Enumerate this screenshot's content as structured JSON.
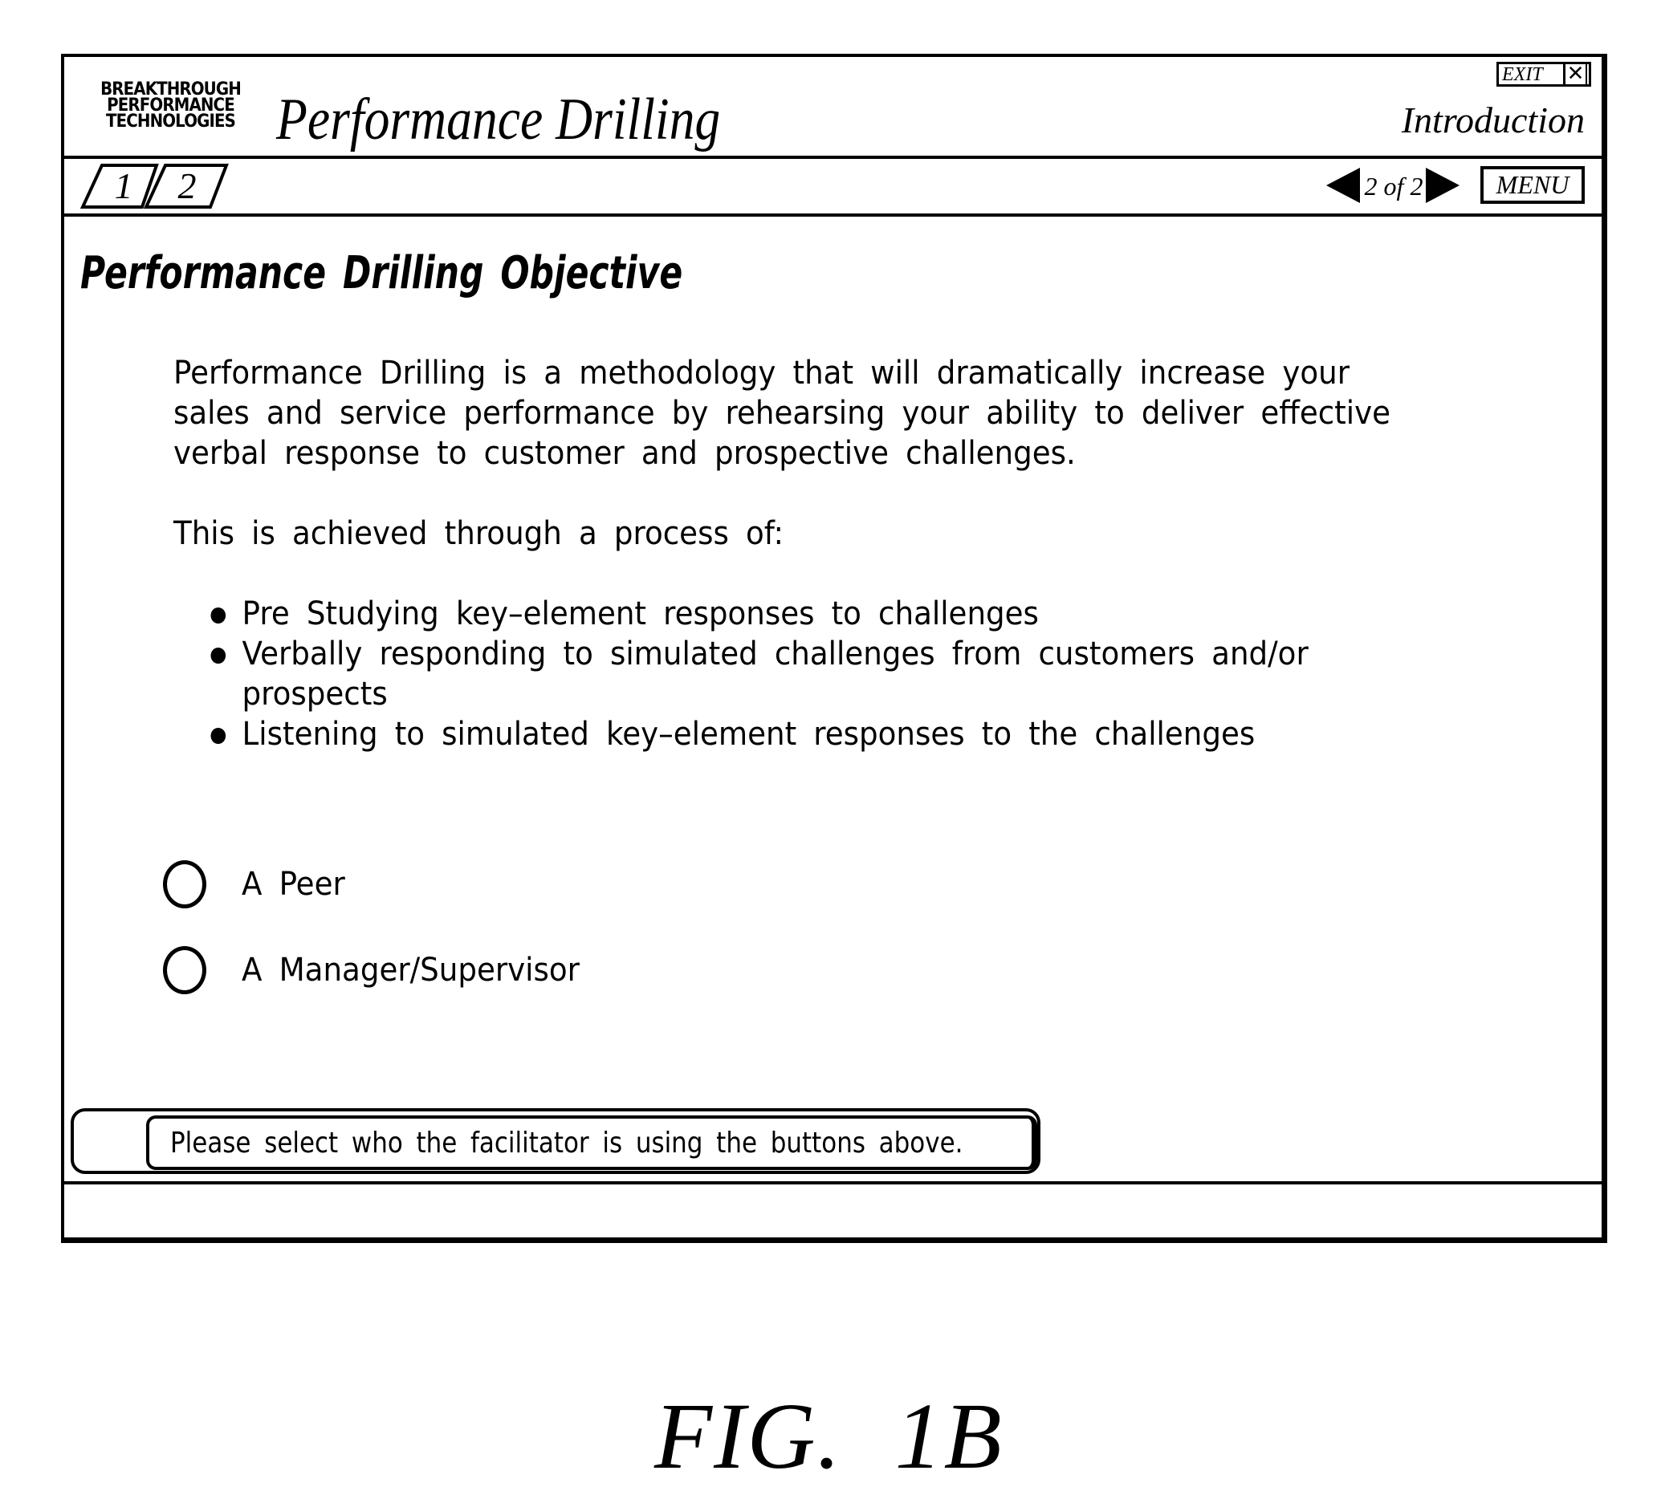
{
  "header": {
    "logo_lines": [
      "BREAKTHROUGH",
      "PERFORMANCE",
      "TECHNOLOGIES"
    ],
    "app_title": "Performance Drilling",
    "exit_label": "EXIT",
    "exit_icon": "close-x-icon",
    "section_title": "Introduction"
  },
  "toolbar": {
    "tabs": [
      {
        "label": "1"
      },
      {
        "label": "2"
      }
    ],
    "prev_icon": "left-triangle-icon",
    "page_indicator": "2 of 2",
    "next_icon": "right-triangle-icon",
    "menu_label": "MENU"
  },
  "content": {
    "heading": "Performance Drilling Objective",
    "intro_lines": [
      "Performance Drilling is a methodology that will dramatically increase your",
      "sales and service performance by rehearsing your ability to deliver effective",
      "verbal response to customer and prospective challenges."
    ],
    "process_lead": "This is achieved through a process of:",
    "bullets": [
      "Pre Studying key–element responses to challenges",
      "Verbally responding to simulated challenges from customers and/or prospects",
      "Listening to simulated key–element responses to the challenges"
    ],
    "options": [
      {
        "label": "A Peer",
        "selected": false
      },
      {
        "label": "A Manager/Supervisor",
        "selected": false
      }
    ]
  },
  "status_bar": {
    "message": "Please select who the facilitator is using the buttons above."
  },
  "figure_caption": "FIG. 1B"
}
